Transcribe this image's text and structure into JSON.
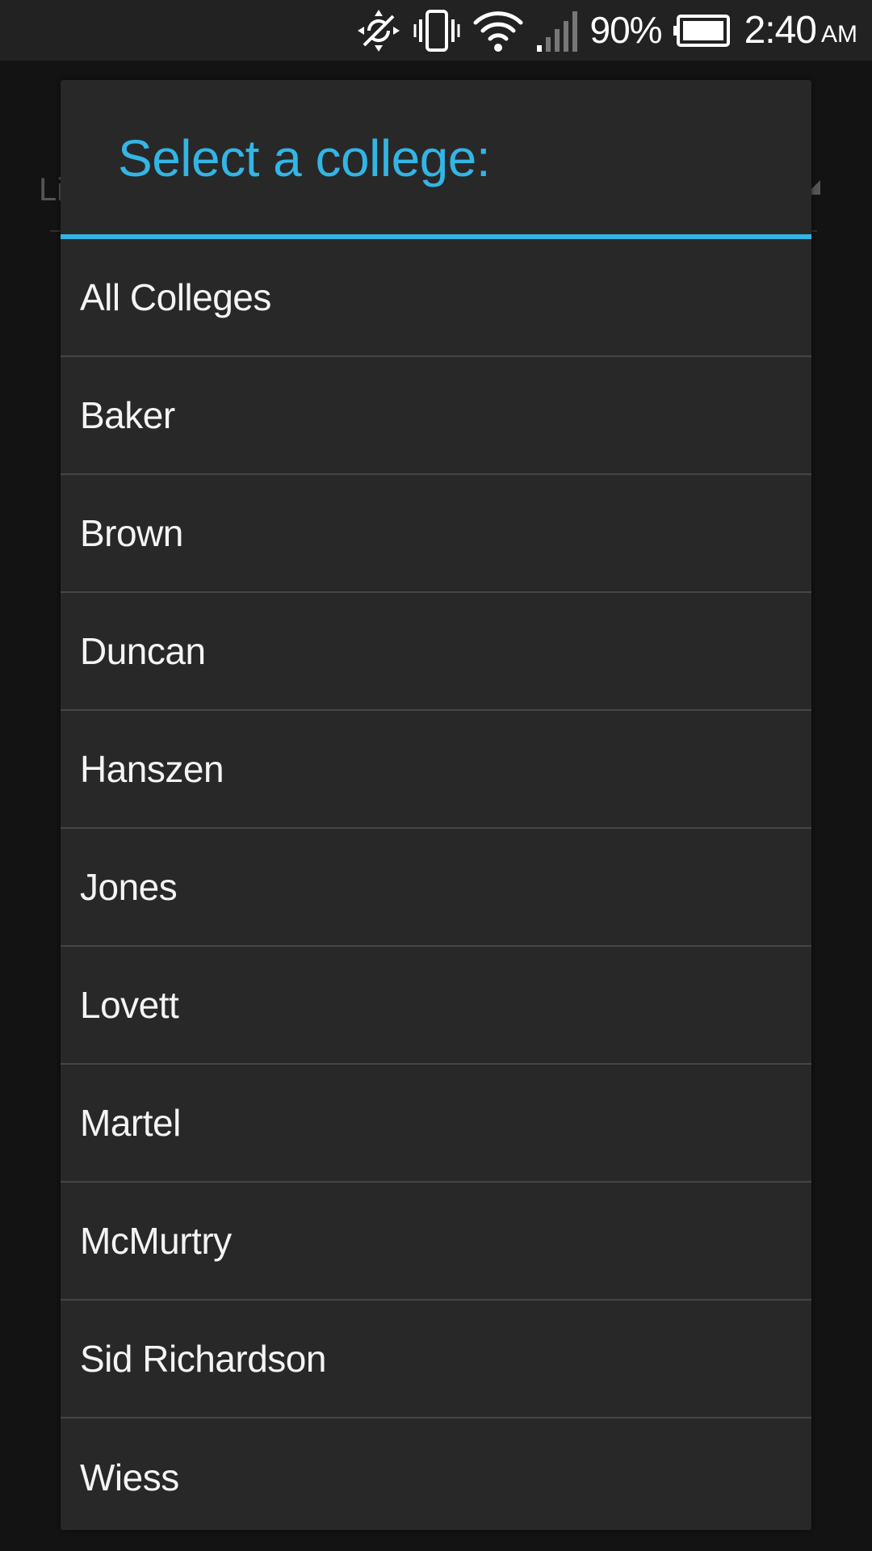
{
  "status_bar": {
    "icons": [
      "sync-disabled-icon",
      "vibrate-icon",
      "wifi-icon",
      "cell-signal-icon",
      "battery-icon"
    ],
    "battery_percent": "90%",
    "battery_level": 0.9,
    "time": "2:40",
    "ampm": "AM"
  },
  "background": {
    "spinner_text": "Li"
  },
  "dialog": {
    "title": "Select a college:",
    "accent_color": "#33b5e5",
    "items": [
      {
        "label": "All Colleges"
      },
      {
        "label": "Baker"
      },
      {
        "label": "Brown"
      },
      {
        "label": "Duncan"
      },
      {
        "label": "Hanszen"
      },
      {
        "label": "Jones"
      },
      {
        "label": "Lovett"
      },
      {
        "label": "Martel"
      },
      {
        "label": "McMurtry"
      },
      {
        "label": "Sid Richardson"
      },
      {
        "label": "Wiess"
      }
    ]
  }
}
